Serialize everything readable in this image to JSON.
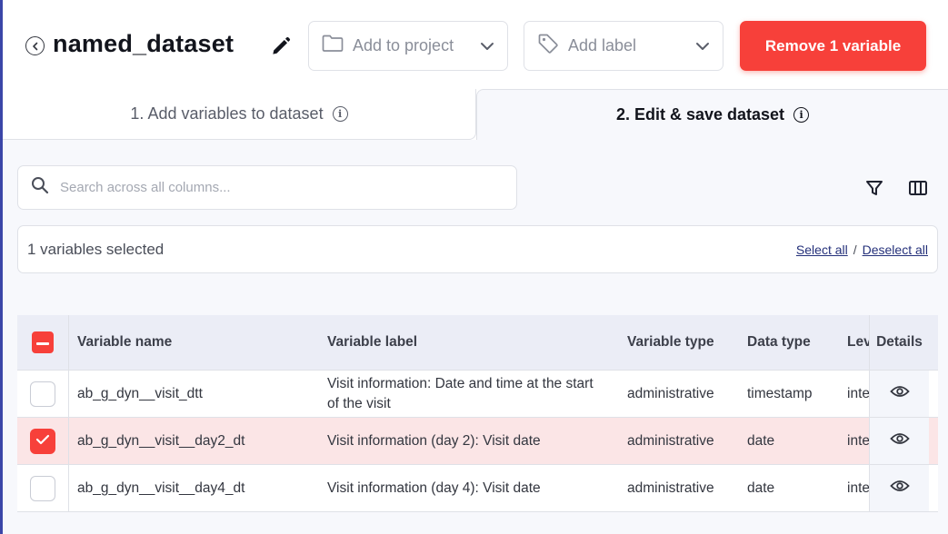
{
  "header": {
    "title": "named_dataset",
    "project_dropdown": {
      "label": "Add to project"
    },
    "label_dropdown": {
      "label": "Add label"
    },
    "remove_button": "Remove 1 variable"
  },
  "tabs": [
    {
      "label": "1. Add variables to dataset",
      "active": false
    },
    {
      "label": "2. Edit & save dataset",
      "active": true
    }
  ],
  "search": {
    "placeholder": "Search across all columns..."
  },
  "selection": {
    "count_text": "1 variables selected",
    "select_all": "Select all",
    "separator": "/",
    "deselect_all": "Deselect all"
  },
  "table": {
    "columns": [
      "Variable name",
      "Variable label",
      "Variable type",
      "Data type",
      "Level",
      "Details"
    ],
    "rows": [
      {
        "name": "ab_g_dyn__visit_dtt",
        "label": "Visit information: Date and time at the start of the visit",
        "vtype": "administrative",
        "dtype": "timestamp",
        "level": "interval",
        "selected": false
      },
      {
        "name": "ab_g_dyn__visit__day2_dt",
        "label": "Visit information (day 2): Visit date",
        "vtype": "administrative",
        "dtype": "date",
        "level": "interval",
        "selected": true
      },
      {
        "name": "ab_g_dyn__visit__day4_dt",
        "label": "Visit information (day 4): Visit date",
        "vtype": "administrative",
        "dtype": "date",
        "level": "interval",
        "selected": false
      }
    ]
  },
  "colors": {
    "accent_red": "#f7403a",
    "header_bg": "#ebedf6",
    "selected_row": "#fbe5e6",
    "link": "#24307a"
  },
  "icons": [
    "back-icon",
    "pencil-icon",
    "folder-icon",
    "tag-icon",
    "chevron-down-icon",
    "info-icon",
    "search-icon",
    "filter-icon",
    "columns-icon",
    "eye-icon",
    "checkmark-icon",
    "minus-icon"
  ]
}
